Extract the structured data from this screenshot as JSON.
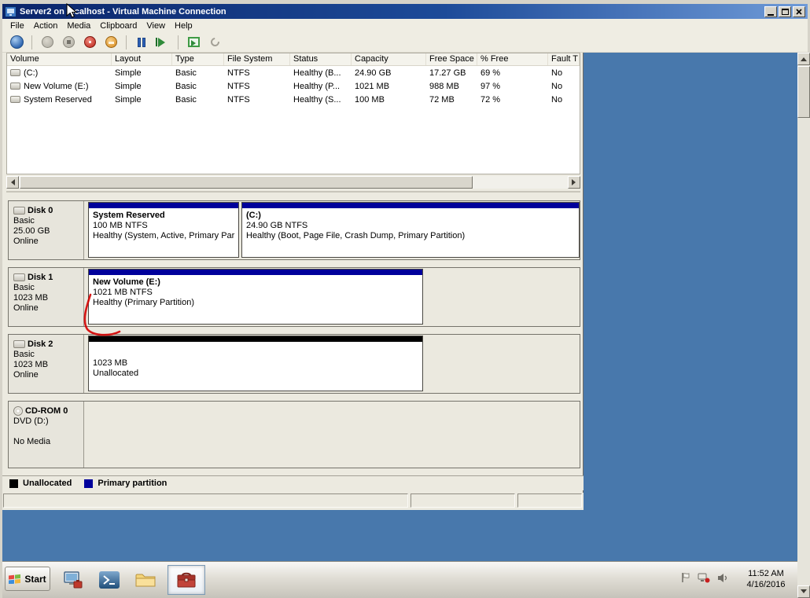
{
  "window": {
    "title": "Server2 on localhost - Virtual Machine Connection",
    "menu": [
      "File",
      "Action",
      "Media",
      "Clipboard",
      "View",
      "Help"
    ],
    "toolbar_buttons": [
      "ctrl-alt-del",
      "start",
      "turn-off",
      "shut-down",
      "save",
      "pause",
      "reset",
      "snapshot",
      "revert"
    ]
  },
  "disk_management": {
    "volume_list": {
      "columns": [
        "Volume",
        "Layout",
        "Type",
        "File System",
        "Status",
        "Capacity",
        "Free Space",
        "% Free",
        "Fault T"
      ],
      "rows": [
        {
          "volume": "(C:)",
          "layout": "Simple",
          "type": "Basic",
          "file_system": "NTFS",
          "status": "Healthy (B...",
          "capacity": "24.90 GB",
          "free_space": "17.27 GB",
          "pct_free": "69 %",
          "fault_tolerance": "No"
        },
        {
          "volume": "New Volume (E:)",
          "layout": "Simple",
          "type": "Basic",
          "file_system": "NTFS",
          "status": "Healthy (P...",
          "capacity": "1021 MB",
          "free_space": "988 MB",
          "pct_free": "97 %",
          "fault_tolerance": "No"
        },
        {
          "volume": "System Reserved",
          "layout": "Simple",
          "type": "Basic",
          "file_system": "NTFS",
          "status": "Healthy (S...",
          "capacity": "100 MB",
          "free_space": "72 MB",
          "pct_free": "72 %",
          "fault_tolerance": "No"
        }
      ]
    },
    "disks": [
      {
        "name": "Disk 0",
        "kind": "Basic",
        "size": "25.00 GB",
        "status": "Online",
        "partitions": [
          {
            "title": "System Reserved",
            "size_fs": "100 MB NTFS",
            "status": "Healthy (System, Active, Primary Par",
            "kind": "primary"
          },
          {
            "title": "(C:)",
            "size_fs": "24.90 GB NTFS",
            "status": "Healthy (Boot, Page File, Crash Dump, Primary Partition)",
            "kind": "primary"
          }
        ]
      },
      {
        "name": "Disk 1",
        "kind": "Basic",
        "size": "1023 MB",
        "status": "Online",
        "partitions": [
          {
            "title": "New Volume (E:)",
            "size_fs": "1021 MB NTFS",
            "status": "Healthy (Primary Partition)",
            "kind": "primary"
          }
        ]
      },
      {
        "name": "Disk 2",
        "kind": "Basic",
        "size": "1023 MB",
        "status": "Online",
        "partitions": [
          {
            "title": "",
            "size_fs": "1023 MB",
            "status": "Unallocated",
            "kind": "unallocated"
          }
        ]
      },
      {
        "name": "CD-ROM 0",
        "kind": "DVD (D:)",
        "size": "",
        "status": "No Media",
        "partitions": []
      }
    ],
    "legend": [
      {
        "label": "Unallocated",
        "color": "#000000"
      },
      {
        "label": "Primary partition",
        "color": "#00009B"
      }
    ]
  },
  "taskbar": {
    "start_label": "Start",
    "quick_launch": [
      "server-manager",
      "powershell",
      "windows-explorer",
      "toolbox"
    ],
    "tray_icons": [
      "flag",
      "network",
      "volume"
    ],
    "clock_time": "11:52 AM",
    "clock_date": "4/16/2016"
  },
  "colors": {
    "desktop": "#4878AC",
    "primary_partition": "#00009B",
    "unallocated": "#000000",
    "annotation_red": "#D40000"
  }
}
